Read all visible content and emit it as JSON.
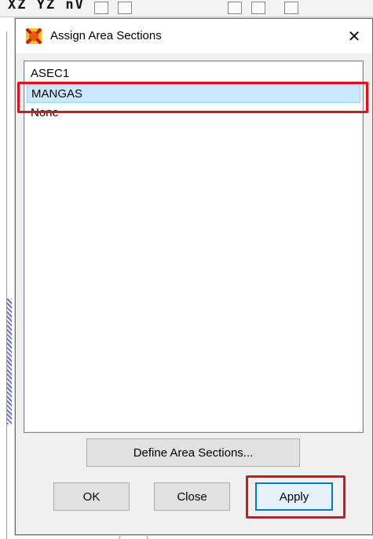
{
  "background": {
    "toolbar_text": "XZ YZ nV"
  },
  "dialog": {
    "title": "Assign Area Sections",
    "close_glyph": "✕",
    "sections": [
      {
        "label": "ASEC1",
        "selected": false
      },
      {
        "label": "MANGAS",
        "selected": true
      },
      {
        "label": "None",
        "selected": false
      }
    ],
    "buttons": {
      "define": "Define Area Sections...",
      "ok": "OK",
      "close": "Close",
      "apply": "Apply"
    }
  },
  "colors": {
    "highlight_red": "#e3101a",
    "selection_bg": "#cce8ff",
    "default_button_border": "#0078d7"
  },
  "icons": [
    "sap-app-icon",
    "close-icon"
  ]
}
